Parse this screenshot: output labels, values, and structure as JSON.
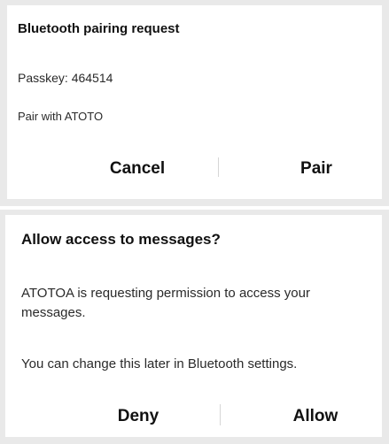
{
  "pairing_dialog": {
    "title": "Bluetooth pairing request",
    "passkey_text": "Passkey: 464514",
    "pair_with_text": "Pair with ATOTO",
    "cancel_label": "Cancel",
    "pair_label": "Pair"
  },
  "access_dialog": {
    "title": "Allow access to messages?",
    "message": "ATOTOA is requesting permission to access your messages.",
    "note": "You can change this later in Bluetooth settings.",
    "deny_label": "Deny",
    "allow_label": "Allow"
  },
  "colors": {
    "frame": "#e9e9e9",
    "background": "#ffffff",
    "text": "#1c1c1c"
  }
}
